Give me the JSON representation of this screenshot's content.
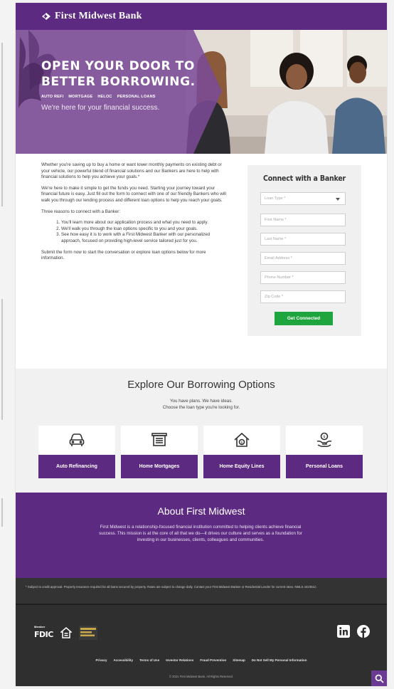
{
  "header": {
    "bank_name": "First Midwest Bank"
  },
  "hero": {
    "title_line1": "OPEN YOUR DOOR TO",
    "title_line2": "BETTER BORROWING.",
    "tags": [
      "AUTO REFI",
      "MORTGAGE",
      "HELOC",
      "PERSONAL LOANS"
    ],
    "subtitle": "We're here for your financial success."
  },
  "intro": {
    "p1": "Whether you're saving up to buy a home or want lower monthly payments on existing debt or your vehicle, our powerful blend of financial solutions and our Bankers are here to help with financial solutions to help you achieve your goals.*",
    "p2": "We're here to make it simple to get the funds you need. Starting your journey toward your financial future is easy. Just fill out the form to connect with one of our friendly Bankers who will walk you through our lending process and different loan options to help you reach your goals.",
    "p3": "Three reasons to connect with a Banker:",
    "reasons": [
      "You'll learn more about our application process and what you need to apply.",
      "We'll walk you through the loan options specific to you and your goals.",
      "See how easy it is to work with a First Midwest Banker with our personalized approach, focused on providing high-level service tailored just for you."
    ],
    "p4": "Submit the form now to start the conversation or explore loan options below for more information."
  },
  "form": {
    "title": "Connect with a Banker",
    "loan_type_placeholder": "Loan Type *",
    "first_name_placeholder": "First Name *",
    "last_name_placeholder": "Last Name *",
    "email_placeholder": "Email Address *",
    "phone_placeholder": "Phone Number *",
    "zip_placeholder": "Zip Code *",
    "submit_label": "Get Connected"
  },
  "explore": {
    "title": "Explore Our Borrowing Options",
    "sub1": "You have plans. We have ideas.",
    "sub2": "Choose the loan type you're looking for.",
    "cards": [
      {
        "label": "Auto Refinancing",
        "icon": "car-icon"
      },
      {
        "label": "Home Mortgages",
        "icon": "house-icon"
      },
      {
        "label": "Home Equity Lines",
        "icon": "home-equity-icon"
      },
      {
        "label": "Personal Loans",
        "icon": "hand-coin-icon"
      }
    ]
  },
  "about": {
    "title": "About First Midwest",
    "copy": "First Midwest is a relationship-focused financial institution committed to helping clients achieve financial success. This mission is at the core of all that we do—it drives our culture and serves as a foundation for investing in our businesses, clients, colleagues and communities."
  },
  "disclaimer": "* Subject to credit approval. Property insurance required for all loans secured by property. Rates are subject to change daily. Contact your First Midwest Banker or Residential Lender for current rates. NMLS 442351C",
  "footer": {
    "fdic_member": "Member",
    "fdic": "FDIC",
    "links": [
      "Privacy",
      "Accessibility",
      "Terms of Use",
      "Investor Relations",
      "Fraud Prevention",
      "Sitemap",
      "Do Not Sell My Personal Information"
    ],
    "copyright": "© 2021 First Midwest Bank. All Rights Reserved."
  },
  "colors": {
    "brand_purple": "#5d2a82",
    "cta_green": "#1fa53d",
    "footer_dark": "#2f2f2f"
  }
}
